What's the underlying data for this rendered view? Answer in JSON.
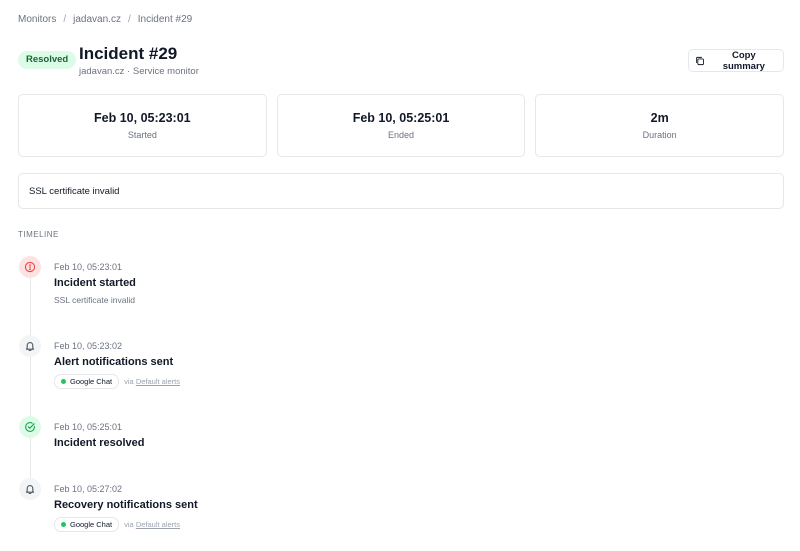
{
  "breadcrumb": {
    "items": [
      "Monitors",
      "jadavan.cz",
      "Incident #29"
    ],
    "separator": "/"
  },
  "header": {
    "status": "Resolved",
    "status_color": "#166534",
    "status_bg": "#dcfce7",
    "title": "Incident #29",
    "subtitle": "jadavan.cz · Service monitor",
    "copy_label": "Copy summary"
  },
  "stats": [
    {
      "value": "Feb 10, 05:23:01",
      "label": "Started"
    },
    {
      "value": "Feb 10, 05:25:01",
      "label": "Ended"
    },
    {
      "value": "2m",
      "label": "Duration"
    }
  ],
  "cause": "SSL certificate invalid",
  "timeline": {
    "heading": "TIMELINE",
    "events": [
      {
        "icon": "alert-circle-icon",
        "time": "Feb 10, 05:23:01",
        "title": "Incident started",
        "detail": "SSL certificate invalid"
      },
      {
        "icon": "bell-icon",
        "time": "Feb 10, 05:23:02",
        "title": "Alert notifications sent",
        "channel": "Google Chat",
        "via": "via",
        "via_link": "Default alerts"
      },
      {
        "icon": "check-circle-icon",
        "time": "Feb 10, 05:25:01",
        "title": "Incident resolved"
      },
      {
        "icon": "bell-icon",
        "time": "Feb 10, 05:27:02",
        "title": "Recovery notifications sent",
        "channel": "Google Chat",
        "via": "via",
        "via_link": "Default alerts"
      }
    ]
  },
  "colors": {
    "accent_red": "#ef4444",
    "accent_green": "#22c55e",
    "border": "#e5e7eb"
  }
}
